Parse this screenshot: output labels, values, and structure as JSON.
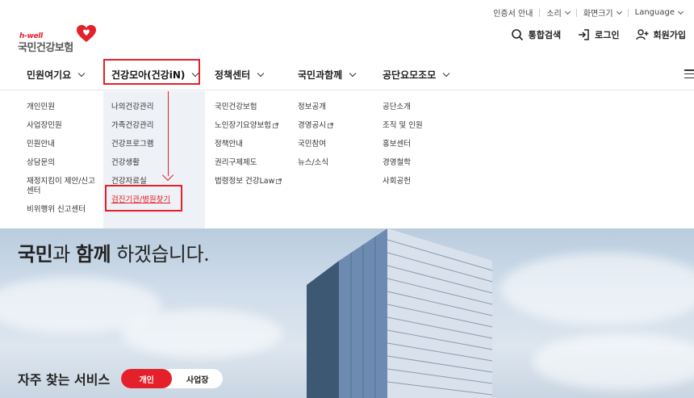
{
  "utility": {
    "cert": "인증서 안내",
    "sound": "소리",
    "zoom": "화면크기",
    "language": "Language"
  },
  "logo": {
    "sub": "h-well",
    "main": "국민건강보험"
  },
  "header_actions": {
    "search": "통합검색",
    "login": "로그인",
    "signup": "회원가입"
  },
  "gnb": [
    {
      "label": "민원여기요"
    },
    {
      "label": "건강모아(건강iN)"
    },
    {
      "label": "정책센터"
    },
    {
      "label": "국민과함께"
    },
    {
      "label": "공단요모조모"
    }
  ],
  "menu": {
    "col1": [
      "개인민원",
      "사업장민원",
      "민원안내",
      "상담문의",
      "재정지킴이 제안/신고센터",
      "비위행위 신고센터"
    ],
    "col2": [
      "나의건강관리",
      "가족건강관리",
      "건강프로그램",
      "건강생활",
      "건강자료실",
      "검진기관/병원찾기"
    ],
    "col3": [
      "국민건강보험",
      "노인장기요양보험",
      "정책안내",
      "권리구제제도",
      "법령정보 건강Law"
    ],
    "col4": [
      "정보공개",
      "경영공시",
      "국민참여",
      "뉴스/소식"
    ],
    "col5": [
      "공단소개",
      "조직 및 인원",
      "홍보센터",
      "경영철학",
      "사회공헌"
    ]
  },
  "hero": {
    "line_parts": [
      "국민",
      "과 ",
      "함께",
      " 하겠습니다."
    ]
  },
  "services": {
    "title": "자주 찾는 서비스",
    "tab_personal": "개인",
    "tab_business": "사업장"
  },
  "colors": {
    "accent": "#e4202a",
    "menu_highlight_bg": "#eef1f6"
  }
}
